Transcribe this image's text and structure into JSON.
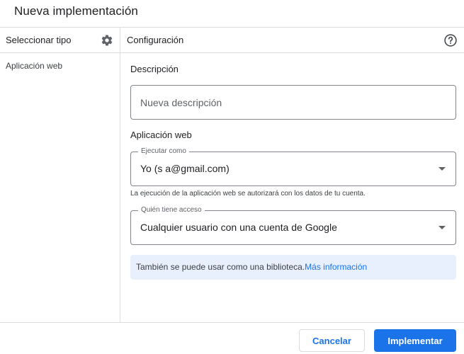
{
  "dialog": {
    "title": "Nueva implementación"
  },
  "sidebar": {
    "header_label": "Seleccionar tipo",
    "header_icon": "gear-icon",
    "items": [
      {
        "label": "Aplicación web"
      }
    ]
  },
  "config": {
    "header_label": "Configuración",
    "help_icon": "help-circle-icon",
    "description": {
      "label": "Descripción",
      "placeholder": "Nueva descripción",
      "value": ""
    },
    "webapp_section": {
      "label": "Aplicación web"
    },
    "execute_as": {
      "label": "Ejecutar como",
      "value": "Yo (s            a@gmail.com)",
      "helper": "La ejecución de la aplicación web se autorizará con los datos de tu cuenta."
    },
    "access": {
      "label": "Quién tiene acceso",
      "value": "Cualquier usuario con una cuenta de Google"
    },
    "info": {
      "text": "También se puede usar como una biblioteca.",
      "link": "Más información"
    }
  },
  "footer": {
    "cancel_label": "Cancelar",
    "primary_label": "Implementar"
  },
  "colors": {
    "accent": "#1a73e8",
    "info_bg": "#e8f0fe",
    "divider": "#dadce0",
    "text": "#202124",
    "secondary_text": "#5f6368"
  }
}
